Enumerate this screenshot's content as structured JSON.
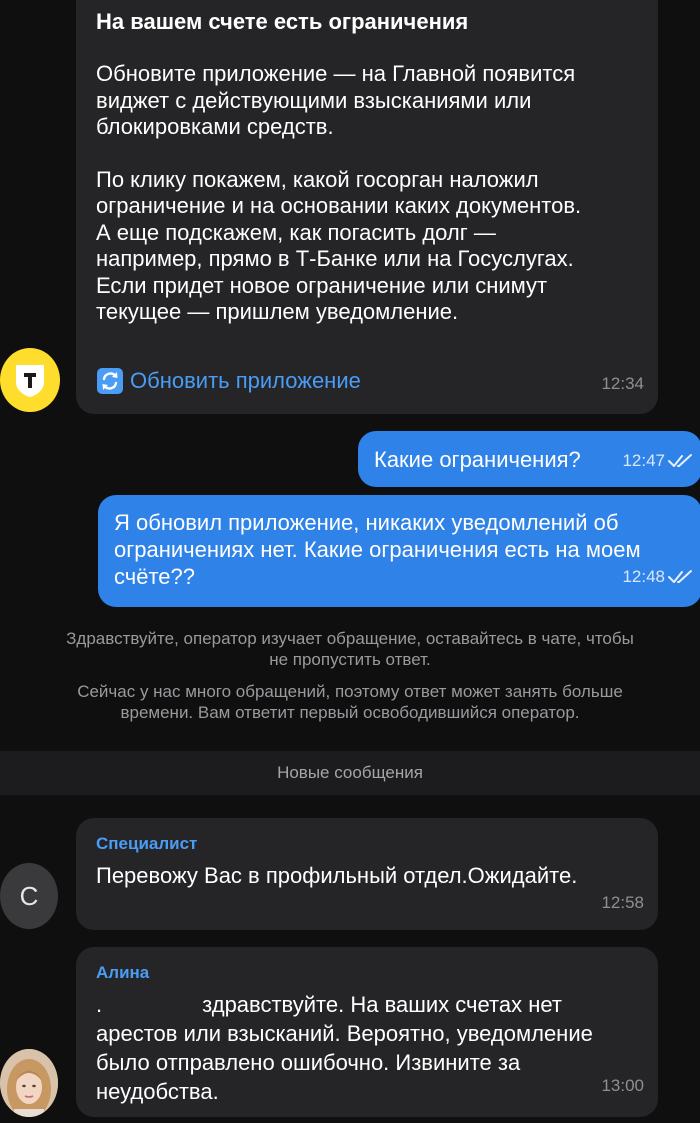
{
  "colors": {
    "background": "#0f0f10",
    "incoming_bubble": "#252527",
    "outgoing_bubble": "#2f82e8",
    "link": "#4a9cf5",
    "bank_logo_bg": "#ffdd2d"
  },
  "messages": [
    {
      "title": "На вашем счете есть ограничения",
      "paragraph_1": "Обновите приложение — на Главной появится\nвиджет с действующими взысканиями или\nблокировками средств.",
      "paragraph_2": "По клику покажем, какой госорган наложил\nограничение и на основании каких документов.\nА еще подскажем, как погасить долг —\nнапример, прямо в Т-Банке или на Госуслугах.\nЕсли придет новое ограничение или снимут\nтекущее — пришлем уведомление.",
      "action_label": "Обновить приложение",
      "action_icon": "refresh-icon",
      "time": "12:34"
    },
    {
      "text": "Какие ограничения?",
      "time": "12:47",
      "status_icon": "double-check-icon"
    },
    {
      "text": "Я обновил приложение, никаких уведомлений об\nограничениях нет. Какие ограничения есть на моем\nсчёте??",
      "time": "12:48",
      "status_icon": "double-check-icon"
    },
    {
      "sender": "Специалист",
      "avatar_letter": "С",
      "text": "Перевожу Вас в профильный отдел.Ожидайте.",
      "time": "12:58"
    },
    {
      "sender": "Алина",
      "text_prefix": ".",
      "text_first_line": "здравствуйте. На ваших счетах нет",
      "text_rest": "арестов или взысканий. Вероятно, уведомление\nбыло отправлено ошибочно. Извините за\nнеудобства.",
      "time": "13:00"
    }
  ],
  "system_notices": [
    "Здравствуйте, оператор изучает обращение, оставайтесь в чате, чтобы\nне пропустить ответ.",
    "Сейчас у нас много обращений, поэтому ответ может занять больше\nвремени. Вам ответит первый освободившийся оператор."
  ],
  "new_messages_label": "Новые сообщения"
}
